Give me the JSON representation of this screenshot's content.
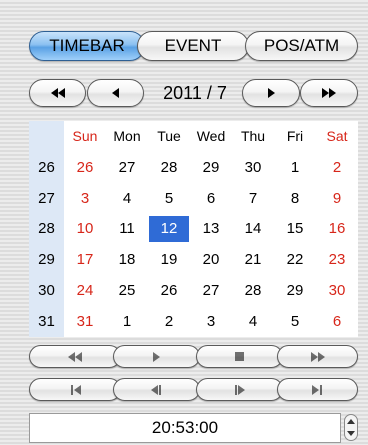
{
  "tabs": [
    {
      "label": "TIMEBAR",
      "active": true
    },
    {
      "label": "EVENT",
      "active": false
    },
    {
      "label": "POS/ATM",
      "active": false
    }
  ],
  "nav": {
    "month_label": "2011 / 7",
    "prev_year_icon": "double-left-arrow-icon",
    "prev_month_icon": "left-arrow-icon",
    "next_month_icon": "right-arrow-icon",
    "next_year_icon": "double-right-arrow-icon"
  },
  "calendar": {
    "weekdays": [
      "Sun",
      "Mon",
      "Tue",
      "Wed",
      "Thu",
      "Fri",
      "Sat"
    ],
    "weeks": [
      {
        "week": "26",
        "days": [
          "26",
          "27",
          "28",
          "29",
          "30",
          "1",
          "2"
        ]
      },
      {
        "week": "27",
        "days": [
          "3",
          "4",
          "5",
          "6",
          "7",
          "8",
          "9"
        ]
      },
      {
        "week": "28",
        "days": [
          "10",
          "11",
          "12",
          "13",
          "14",
          "15",
          "16"
        ]
      },
      {
        "week": "29",
        "days": [
          "17",
          "18",
          "19",
          "20",
          "21",
          "22",
          "23"
        ]
      },
      {
        "week": "30",
        "days": [
          "24",
          "25",
          "26",
          "27",
          "28",
          "29",
          "30"
        ]
      },
      {
        "week": "31",
        "days": [
          "31",
          "1",
          "2",
          "3",
          "4",
          "5",
          "6"
        ]
      }
    ],
    "selected_day": "12",
    "weekend_color": "#d7261a",
    "selection_color": "#2f6bd6"
  },
  "playback_controls": {
    "row1": [
      "rewind-icon",
      "play-icon",
      "stop-icon",
      "fast-forward-icon"
    ],
    "row2": [
      "skip-to-start-icon",
      "step-back-icon",
      "step-forward-icon",
      "skip-to-end-icon"
    ]
  },
  "time": {
    "value": "20:53:00"
  }
}
